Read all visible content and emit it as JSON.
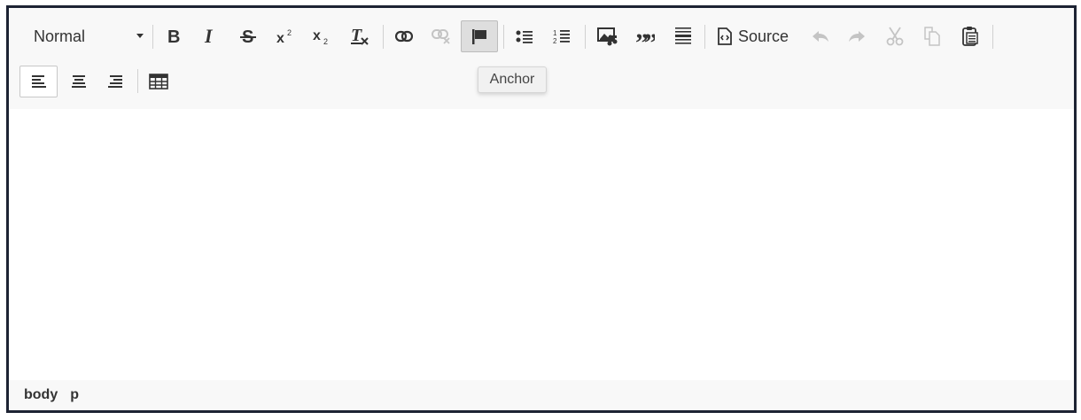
{
  "toolbar": {
    "format_value": "Normal",
    "buttons": {
      "bold": "Bold",
      "italic": "Italic",
      "strike": "Strikethrough",
      "superscript": "Superscript",
      "subscript": "Subscript",
      "remove_format": "Remove Format",
      "link": "Link",
      "unlink": "Unlink",
      "anchor": "Anchor",
      "bulleted_list": "Insert/Remove Bulleted List",
      "numbered_list": "Insert/Remove Numbered List",
      "image": "Image",
      "blockquote": "Block Quote",
      "horizontal_line": "Insert Horizontal Line",
      "source": "Source",
      "undo": "Undo",
      "redo": "Redo",
      "cut": "Cut",
      "copy": "Copy",
      "paste": "Paste",
      "align_left": "Align Left",
      "align_center": "Center",
      "align_right": "Align Right",
      "table": "Table"
    },
    "source_label": "Source"
  },
  "tooltip": {
    "text": "Anchor"
  },
  "pathbar": {
    "items": [
      "body",
      "p"
    ]
  },
  "colors": {
    "border": "#1d2333",
    "toolbar_bg": "#f8f8f8",
    "active_bg": "#dedede",
    "disabled": "#c4c4c4"
  }
}
